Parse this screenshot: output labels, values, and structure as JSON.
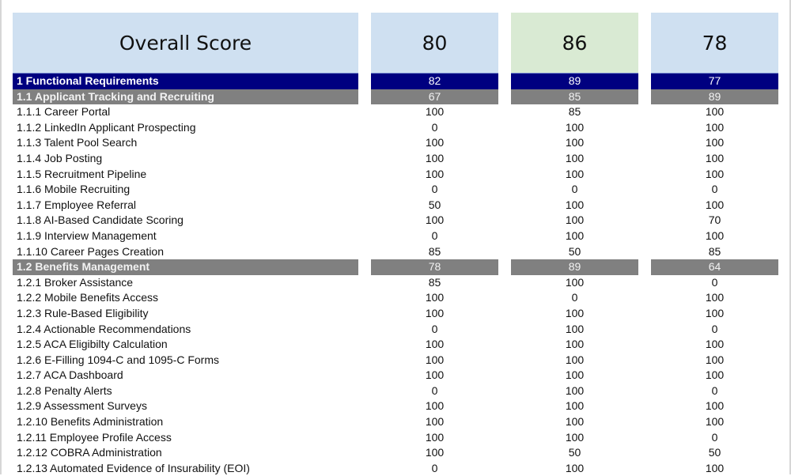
{
  "header": {
    "label": "Overall Score",
    "scores": [
      "80",
      "86",
      "78"
    ]
  },
  "colors": {
    "header_blue": "#cfe0f1",
    "header_green": "#d9ead3",
    "section": "#000080",
    "subsection": "#808080"
  },
  "rows": [
    {
      "type": "section",
      "label": "1 Functional Requirements",
      "values": [
        "82",
        "89",
        "77"
      ]
    },
    {
      "type": "subsection",
      "label": "1.1 Applicant Tracking and Recruiting",
      "values": [
        "67",
        "85",
        "89"
      ]
    },
    {
      "type": "item",
      "label": "1.1.1 Career Portal",
      "values": [
        "100",
        "85",
        "100"
      ]
    },
    {
      "type": "item",
      "label": "1.1.2 LinkedIn Applicant Prospecting",
      "values": [
        "0",
        "100",
        "100"
      ]
    },
    {
      "type": "item",
      "label": "1.1.3 Talent Pool Search",
      "values": [
        "100",
        "100",
        "100"
      ]
    },
    {
      "type": "item",
      "label": "1.1.4 Job Posting",
      "values": [
        "100",
        "100",
        "100"
      ]
    },
    {
      "type": "item",
      "label": "1.1.5 Recruitment Pipeline",
      "values": [
        "100",
        "100",
        "100"
      ]
    },
    {
      "type": "item",
      "label": "1.1.6 Mobile Recruiting",
      "values": [
        "0",
        "0",
        "0"
      ]
    },
    {
      "type": "item",
      "label": "1.1.7 Employee Referral",
      "values": [
        "50",
        "100",
        "100"
      ]
    },
    {
      "type": "item",
      "label": "1.1.8 AI-Based Candidate Scoring",
      "values": [
        "100",
        "100",
        "70"
      ]
    },
    {
      "type": "item",
      "label": "1.1.9 Interview Management",
      "values": [
        "0",
        "100",
        "100"
      ]
    },
    {
      "type": "item",
      "label": "1.1.10 Career Pages Creation",
      "values": [
        "85",
        "50",
        "85"
      ]
    },
    {
      "type": "subsection",
      "label": "1.2 Benefits Management",
      "values": [
        "78",
        "89",
        "64"
      ]
    },
    {
      "type": "item",
      "label": "1.2.1 Broker Assistance",
      "values": [
        "85",
        "100",
        "0"
      ]
    },
    {
      "type": "item",
      "label": "1.2.2 Mobile Benefits Access",
      "values": [
        "100",
        "0",
        "100"
      ]
    },
    {
      "type": "item",
      "label": "1.2.3 Rule-Based Eligibility",
      "values": [
        "100",
        "100",
        "100"
      ]
    },
    {
      "type": "item",
      "label": "1.2.4 Actionable Recommendations",
      "values": [
        "0",
        "100",
        "0"
      ]
    },
    {
      "type": "item",
      "label": "1.2.5 ACA Eligibilty Calculation",
      "values": [
        "100",
        "100",
        "100"
      ]
    },
    {
      "type": "item",
      "label": "1.2.6 E-Filling 1094-C and 1095-C Forms",
      "values": [
        "100",
        "100",
        "100"
      ]
    },
    {
      "type": "item",
      "label": "1.2.7 ACA Dashboard",
      "values": [
        "100",
        "100",
        "100"
      ]
    },
    {
      "type": "item",
      "label": "1.2.8 Penalty Alerts",
      "values": [
        "0",
        "100",
        "0"
      ]
    },
    {
      "type": "item",
      "label": "1.2.9 Assessment Surveys",
      "values": [
        "100",
        "100",
        "100"
      ]
    },
    {
      "type": "item",
      "label": "1.2.10 Benefits Administration",
      "values": [
        "100",
        "100",
        "100"
      ]
    },
    {
      "type": "item",
      "label": "1.2.11 Employee Profile Access",
      "values": [
        "100",
        "100",
        "0"
      ]
    },
    {
      "type": "item",
      "label": "1.2.12 COBRA Administration",
      "values": [
        "100",
        "50",
        "50"
      ]
    },
    {
      "type": "item",
      "label": "1.2.13 Automated Evidence of Insurability (EOI)",
      "values": [
        "0",
        "100",
        "100"
      ]
    }
  ]
}
